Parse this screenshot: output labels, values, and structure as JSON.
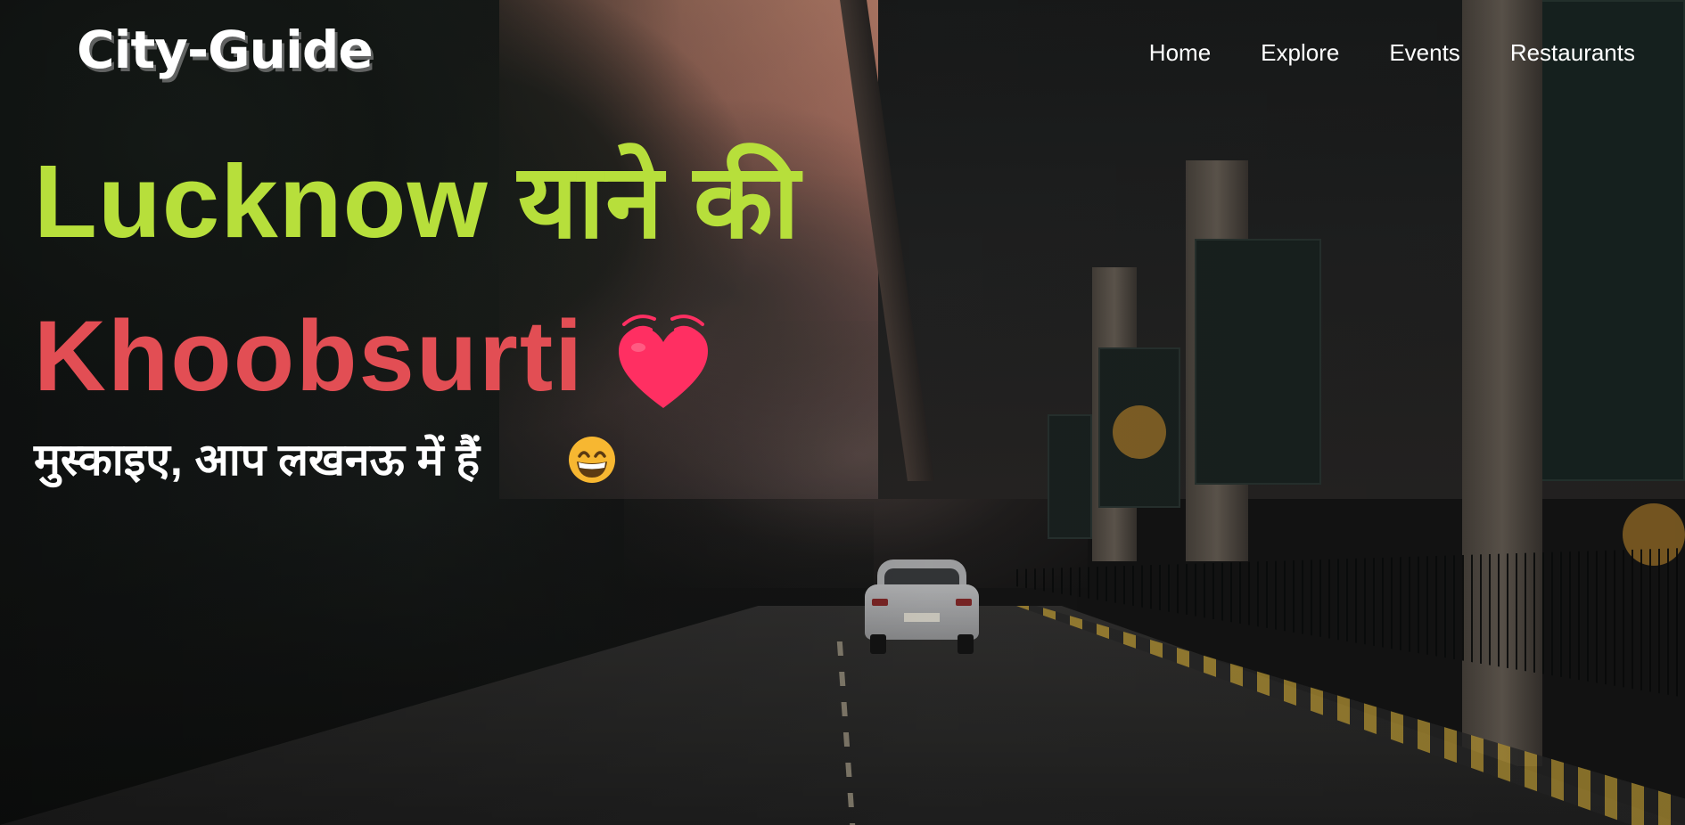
{
  "logo": {
    "text": "City-Guide"
  },
  "nav": {
    "items": [
      {
        "label": "Home"
      },
      {
        "label": "Explore"
      },
      {
        "label": "Events"
      },
      {
        "label": "Restaurants"
      }
    ]
  },
  "hero": {
    "line1": "Lucknow याने की",
    "line2": "Khoobsurti",
    "line3": "मुस्काइए, आप लखनऊ में हैं",
    "line1_color": "#b7df3b",
    "line2_color": "#e24e54",
    "heart_icon": "beating-heart-emoji",
    "grin_icon": "grinning-face-with-smiling-eyes-emoji"
  },
  "colors": {
    "heart": "#ff2f62",
    "emoji_face": "#f7b731",
    "nav_text": "#ffffff"
  }
}
